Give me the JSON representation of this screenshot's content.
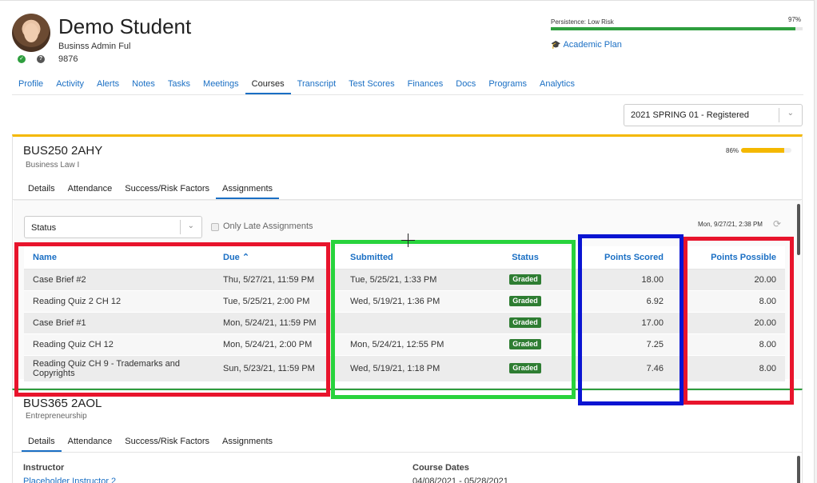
{
  "student": {
    "name": "Demo Student",
    "program": "Businss Admin Ful",
    "id": "9876"
  },
  "persistence": {
    "label": "Persistence: Low Risk",
    "percent_text": "97%",
    "level": 0.97,
    "color": "#2e9e3e"
  },
  "academic_plan": {
    "icon": "graduation-cap-icon",
    "label": "Academic Plan"
  },
  "nav_tabs": [
    "Profile",
    "Activity",
    "Alerts",
    "Notes",
    "Tasks",
    "Meetings",
    "Courses",
    "Transcript",
    "Test Scores",
    "Finances",
    "Docs",
    "Programs",
    "Analytics"
  ],
  "nav_active": "Courses",
  "term_select": {
    "value": "2021 SPRING 01 - Registered"
  },
  "course1": {
    "code": "BUS250 2AHY",
    "title": "Business Law I",
    "percent_text": "86%",
    "level": 0.86,
    "accent": "#f4b800",
    "tabs": [
      "Details",
      "Attendance",
      "Success/Risk Factors",
      "Assignments"
    ],
    "active_tab": "Assignments",
    "status_filter": {
      "value": "Status"
    },
    "late_only_label": "Only Late Assignments",
    "updated": "Mon, 9/27/21, 2:38 PM",
    "columns": {
      "name": "Name",
      "due": "Due",
      "submitted": "Submitted",
      "status": "Status",
      "points_scored": "Points Scored",
      "points_possible": "Points Possible"
    },
    "rows": [
      {
        "name": "Case Brief #2",
        "due": "Thu, 5/27/21, 11:59 PM",
        "submitted": "Tue, 5/25/21, 1:33 PM",
        "status": "Graded",
        "scored": "18.00",
        "possible": "20.00"
      },
      {
        "name": "Reading Quiz 2 CH 12",
        "due": "Tue, 5/25/21, 2:00 PM",
        "submitted": "Wed, 5/19/21, 1:36 PM",
        "status": "Graded",
        "scored": "6.92",
        "possible": "8.00"
      },
      {
        "name": "Case Brief #1",
        "due": "Mon, 5/24/21, 11:59 PM",
        "submitted": "",
        "status": "Graded",
        "scored": "17.00",
        "possible": "20.00"
      },
      {
        "name": "Reading Quiz CH 12",
        "due": "Mon, 5/24/21, 2:00 PM",
        "submitted": "Mon, 5/24/21, 12:55 PM",
        "status": "Graded",
        "scored": "7.25",
        "possible": "8.00"
      },
      {
        "name": "Reading Quiz CH 9 - Trademarks and Copyrights",
        "due": "Sun, 5/23/21, 11:59 PM",
        "submitted": "Wed, 5/19/21, 1:18 PM",
        "status": "Graded",
        "scored": "7.46",
        "possible": "8.00"
      }
    ]
  },
  "course2": {
    "code": "BUS365 2AOL",
    "title": "Entrepreneurship",
    "accent": "#2e9e3e",
    "tabs": [
      "Details",
      "Attendance",
      "Success/Risk Factors",
      "Assignments"
    ],
    "active_tab": "Details",
    "instructor_label": "Instructor",
    "instructor_value": "Placeholder Instructor 2",
    "dates_label": "Course Dates",
    "dates_value": "04/08/2021 - 05/28/2021"
  },
  "highlight_colors": {
    "red": "#e8142c",
    "green": "#28d33c",
    "blue": "#0a14d2"
  }
}
